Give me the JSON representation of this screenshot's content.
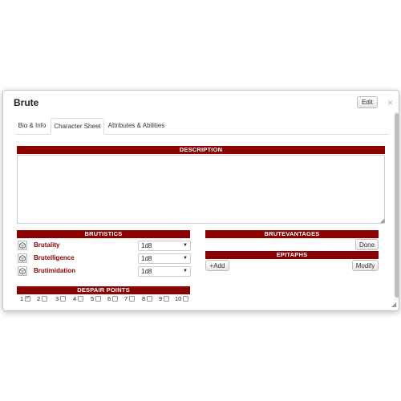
{
  "dialog": {
    "title": "Brute",
    "edit_label": "Edit",
    "close_glyph": "×"
  },
  "tabs": [
    {
      "label": "Bio & Info",
      "active": false
    },
    {
      "label": "Character Sheet",
      "active": true
    },
    {
      "label": "Attributes & Abilities",
      "active": false
    }
  ],
  "sections": {
    "description": "DESCRIPTION",
    "brutistics": "BRUTISTICS",
    "brutevantages": "BRUTEVANTAGES",
    "epitaphs": "EPITAPHS",
    "despair_points": "DESPAIR POINTS"
  },
  "description_value": "",
  "attributes": [
    {
      "label": "Brutality",
      "value": "1d8",
      "icon": "dice-icon"
    },
    {
      "label": "Brutelligence",
      "value": "1d8",
      "icon": "dice-icon"
    },
    {
      "label": "Brutimidation",
      "value": "1d8",
      "icon": "dice-icon"
    }
  ],
  "buttons": {
    "done": "Done",
    "add": "+Add",
    "modify": "Modify"
  },
  "despair_points": [
    {
      "n": "1",
      "checked": true
    },
    {
      "n": "2",
      "checked": false
    },
    {
      "n": "3",
      "checked": false
    },
    {
      "n": "4",
      "checked": false
    },
    {
      "n": "5",
      "checked": false
    },
    {
      "n": "6",
      "checked": false
    },
    {
      "n": "7",
      "checked": false
    },
    {
      "n": "8",
      "checked": false
    },
    {
      "n": "9",
      "checked": false
    },
    {
      "n": "10",
      "checked": false
    }
  ],
  "colors": {
    "section_bar": "#8b0000",
    "attr_label": "#8b0000"
  }
}
